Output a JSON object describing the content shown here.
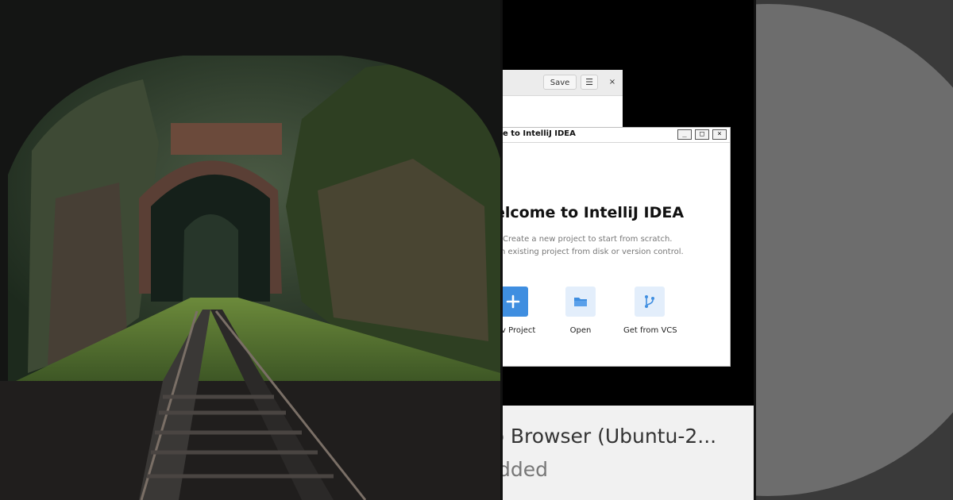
{
  "photo": {
    "description_icon": "tunnel-photo"
  },
  "top_window": {
    "save_label": "Save",
    "menu_glyph": "☰",
    "close_glyph": "×"
  },
  "intellij": {
    "title": "e to IntelliJ IDEA",
    "min_glyph": "_",
    "max_glyph": "□",
    "close_glyph": "×",
    "heading": "elcome to IntelliJ IDEA",
    "line1": "Create a new project to start from scratch.",
    "line2": "n existing project from disk or version control.",
    "actions": [
      {
        "label": "v Project",
        "icon": "plus-icon"
      },
      {
        "label": "Open",
        "icon": "folder-icon"
      },
      {
        "label": "Get from VCS",
        "icon": "vcs-branch-icon"
      }
    ]
  },
  "bottom_card": {
    "line1": "b Browser (Ubuntu-2...",
    "line2": "dded"
  },
  "colors": {
    "accent": "#3f8ee0",
    "tile_light": "#e3eefb",
    "right_bg": "#3a3a3a",
    "right_circle": "#6d6d6d"
  }
}
